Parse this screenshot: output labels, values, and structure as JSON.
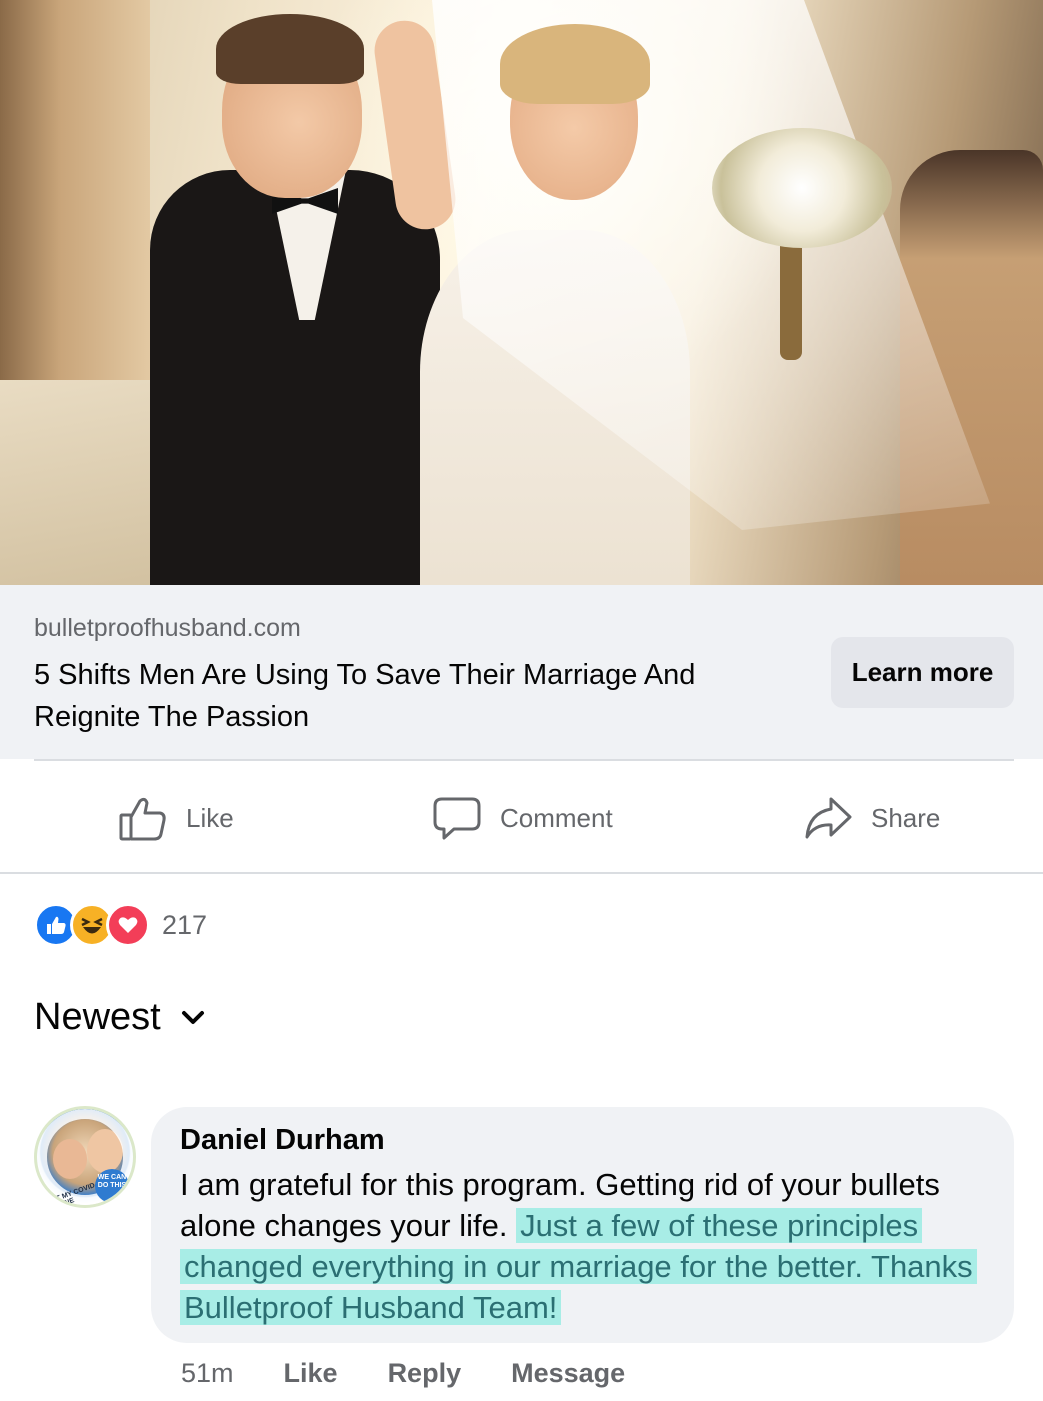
{
  "hero": {
    "image": "wedding-couple-photo"
  },
  "link_preview": {
    "domain": "bulletproofhusband.com",
    "headline": "5 Shifts Men Are Using To Save Their Marriage And Reignite The Passion",
    "cta_label": "Learn more"
  },
  "actions": {
    "like_label": "Like",
    "comment_label": "Comment",
    "share_label": "Share"
  },
  "reactions": {
    "icons": [
      "like-reaction-icon",
      "haha-reaction-icon",
      "love-reaction-icon"
    ],
    "count": "217"
  },
  "sort": {
    "label": "Newest"
  },
  "comment": {
    "author": "Daniel Durham",
    "text_plain": "I am grateful for this program. Getting rid of your bullets alone changes your life. ",
    "text_highlighted": "Just a few of these principles changed everything in our marriage for the better. Thanks Bulletproof Husband Team!",
    "avatar_badge": "WE CAN DO THIS",
    "avatar_ring_text": "I GOT MY COVID-19 VACCINE",
    "timestamp": "51m",
    "like_label": "Like",
    "reply_label": "Reply",
    "message_label": "Message",
    "highlight_color": "#a8ede6"
  },
  "colors": {
    "facebook_blue": "#1877f2",
    "secondary_text": "#65676b",
    "card_bg": "#f0f2f5"
  }
}
